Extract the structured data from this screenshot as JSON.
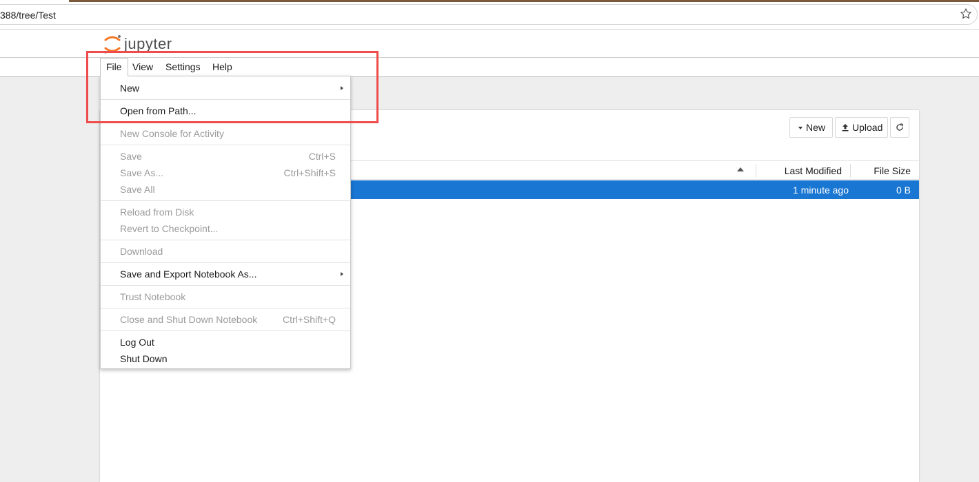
{
  "browser": {
    "url": "388/tree/Test"
  },
  "app": {
    "logo_text": "jupyter"
  },
  "menubar": {
    "items": [
      {
        "label": "File"
      },
      {
        "label": "View"
      },
      {
        "label": "Settings"
      },
      {
        "label": "Help"
      }
    ]
  },
  "file_menu": {
    "items": [
      {
        "label": "New",
        "enabled": true,
        "submenu": true
      },
      {
        "label": "Open from Path...",
        "enabled": true
      },
      {
        "label": "New Console for Activity",
        "enabled": false
      },
      {
        "label": "Save",
        "shortcut": "Ctrl+S",
        "enabled": false
      },
      {
        "label": "Save As...",
        "shortcut": "Ctrl+Shift+S",
        "enabled": false
      },
      {
        "label": "Save All",
        "enabled": false
      },
      {
        "label": "Reload from Disk",
        "enabled": false
      },
      {
        "label": "Revert to Checkpoint...",
        "enabled": false
      },
      {
        "label": "Download",
        "enabled": false
      },
      {
        "label": "Save and Export Notebook As...",
        "enabled": true,
        "submenu": true
      },
      {
        "label": "Trust Notebook",
        "enabled": false
      },
      {
        "label": "Close and Shut Down Notebook",
        "shortcut": "Ctrl+Shift+Q",
        "enabled": false
      },
      {
        "label": "Log Out",
        "enabled": true
      },
      {
        "label": "Shut Down",
        "enabled": true
      }
    ]
  },
  "file_browser": {
    "toolbar": {
      "new_label": "New",
      "upload_label": "Upload"
    },
    "columns": {
      "last_modified": "Last Modified",
      "file_size": "File Size"
    },
    "rows": [
      {
        "modified": "1 minute ago",
        "size": "0 B",
        "selected": true
      }
    ]
  },
  "colors": {
    "selection": "#1976d2",
    "annotation_box": "#ee4b4b",
    "jupyter_orange": "#f37726"
  },
  "icons": [
    "star-icon",
    "jupyter-logo-icon",
    "caret-down-icon",
    "upload-icon",
    "refresh-icon",
    "sort-caret-icon",
    "submenu-arrow-icon"
  ]
}
